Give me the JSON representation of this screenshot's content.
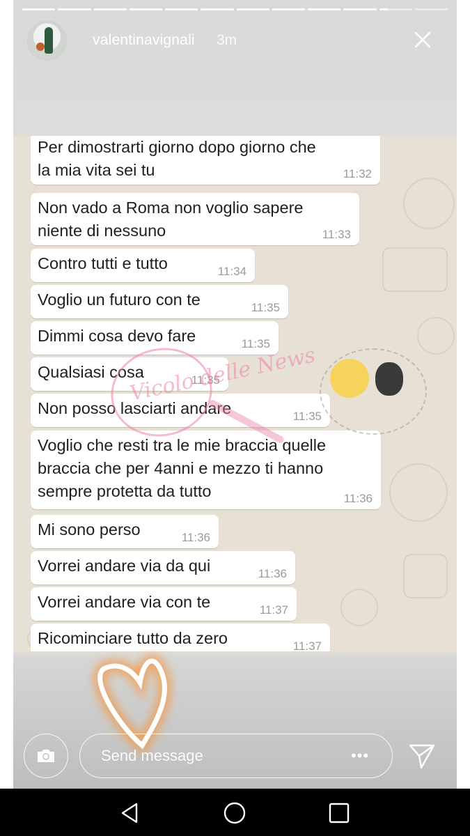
{
  "story": {
    "username": "valentinavignali",
    "time_ago": "3m",
    "progress_segments": 12,
    "active_segment_progress": 0.25
  },
  "chat": {
    "messages": [
      {
        "text": "Per dimostrarti giorno dopo giorno che\nla mia vita sei tu",
        "time": "11:32"
      },
      {
        "text": "Non vado a Roma non voglio sapere\nniente di nessuno",
        "time": "11:33"
      },
      {
        "text": "Contro tutti e tutto",
        "time": "11:34"
      },
      {
        "text": "Voglio un futuro con te",
        "time": "11:35"
      },
      {
        "text": "Dimmi cosa devo fare",
        "time": "11:35"
      },
      {
        "text": "Qualsiasi cosa",
        "time": "11:35"
      },
      {
        "text": "Non posso lasciarti andare",
        "time": "11:35"
      },
      {
        "text": "Voglio che resti tra le mie braccia quelle\nbraccia che per 4anni e mezzo ti hanno\nsempre protetta da tutto",
        "time": "11:36"
      },
      {
        "text": "Mi sono perso",
        "time": "11:36"
      },
      {
        "text": "Vorrei andare via da qui",
        "time": "11:36"
      },
      {
        "text": "Vorrei andare via con te",
        "time": "11:37"
      },
      {
        "text": "Ricominciare tutto da zero",
        "time": "11:37"
      }
    ]
  },
  "watermark": {
    "script_text": "Vicolo delle News"
  },
  "reply": {
    "placeholder": "Send message",
    "more_glyph": "•••"
  },
  "icons": [
    "close-icon",
    "camera-icon",
    "more-icon",
    "send-icon",
    "heart-sticker",
    "nav-back-icon",
    "nav-home-icon",
    "nav-recents-icon"
  ],
  "colors": {
    "bubble": "#ffffff",
    "chat_bg": "#e7e0d4",
    "timestamp": "#9a9a9a",
    "heart_glow": "#f29a4a"
  }
}
